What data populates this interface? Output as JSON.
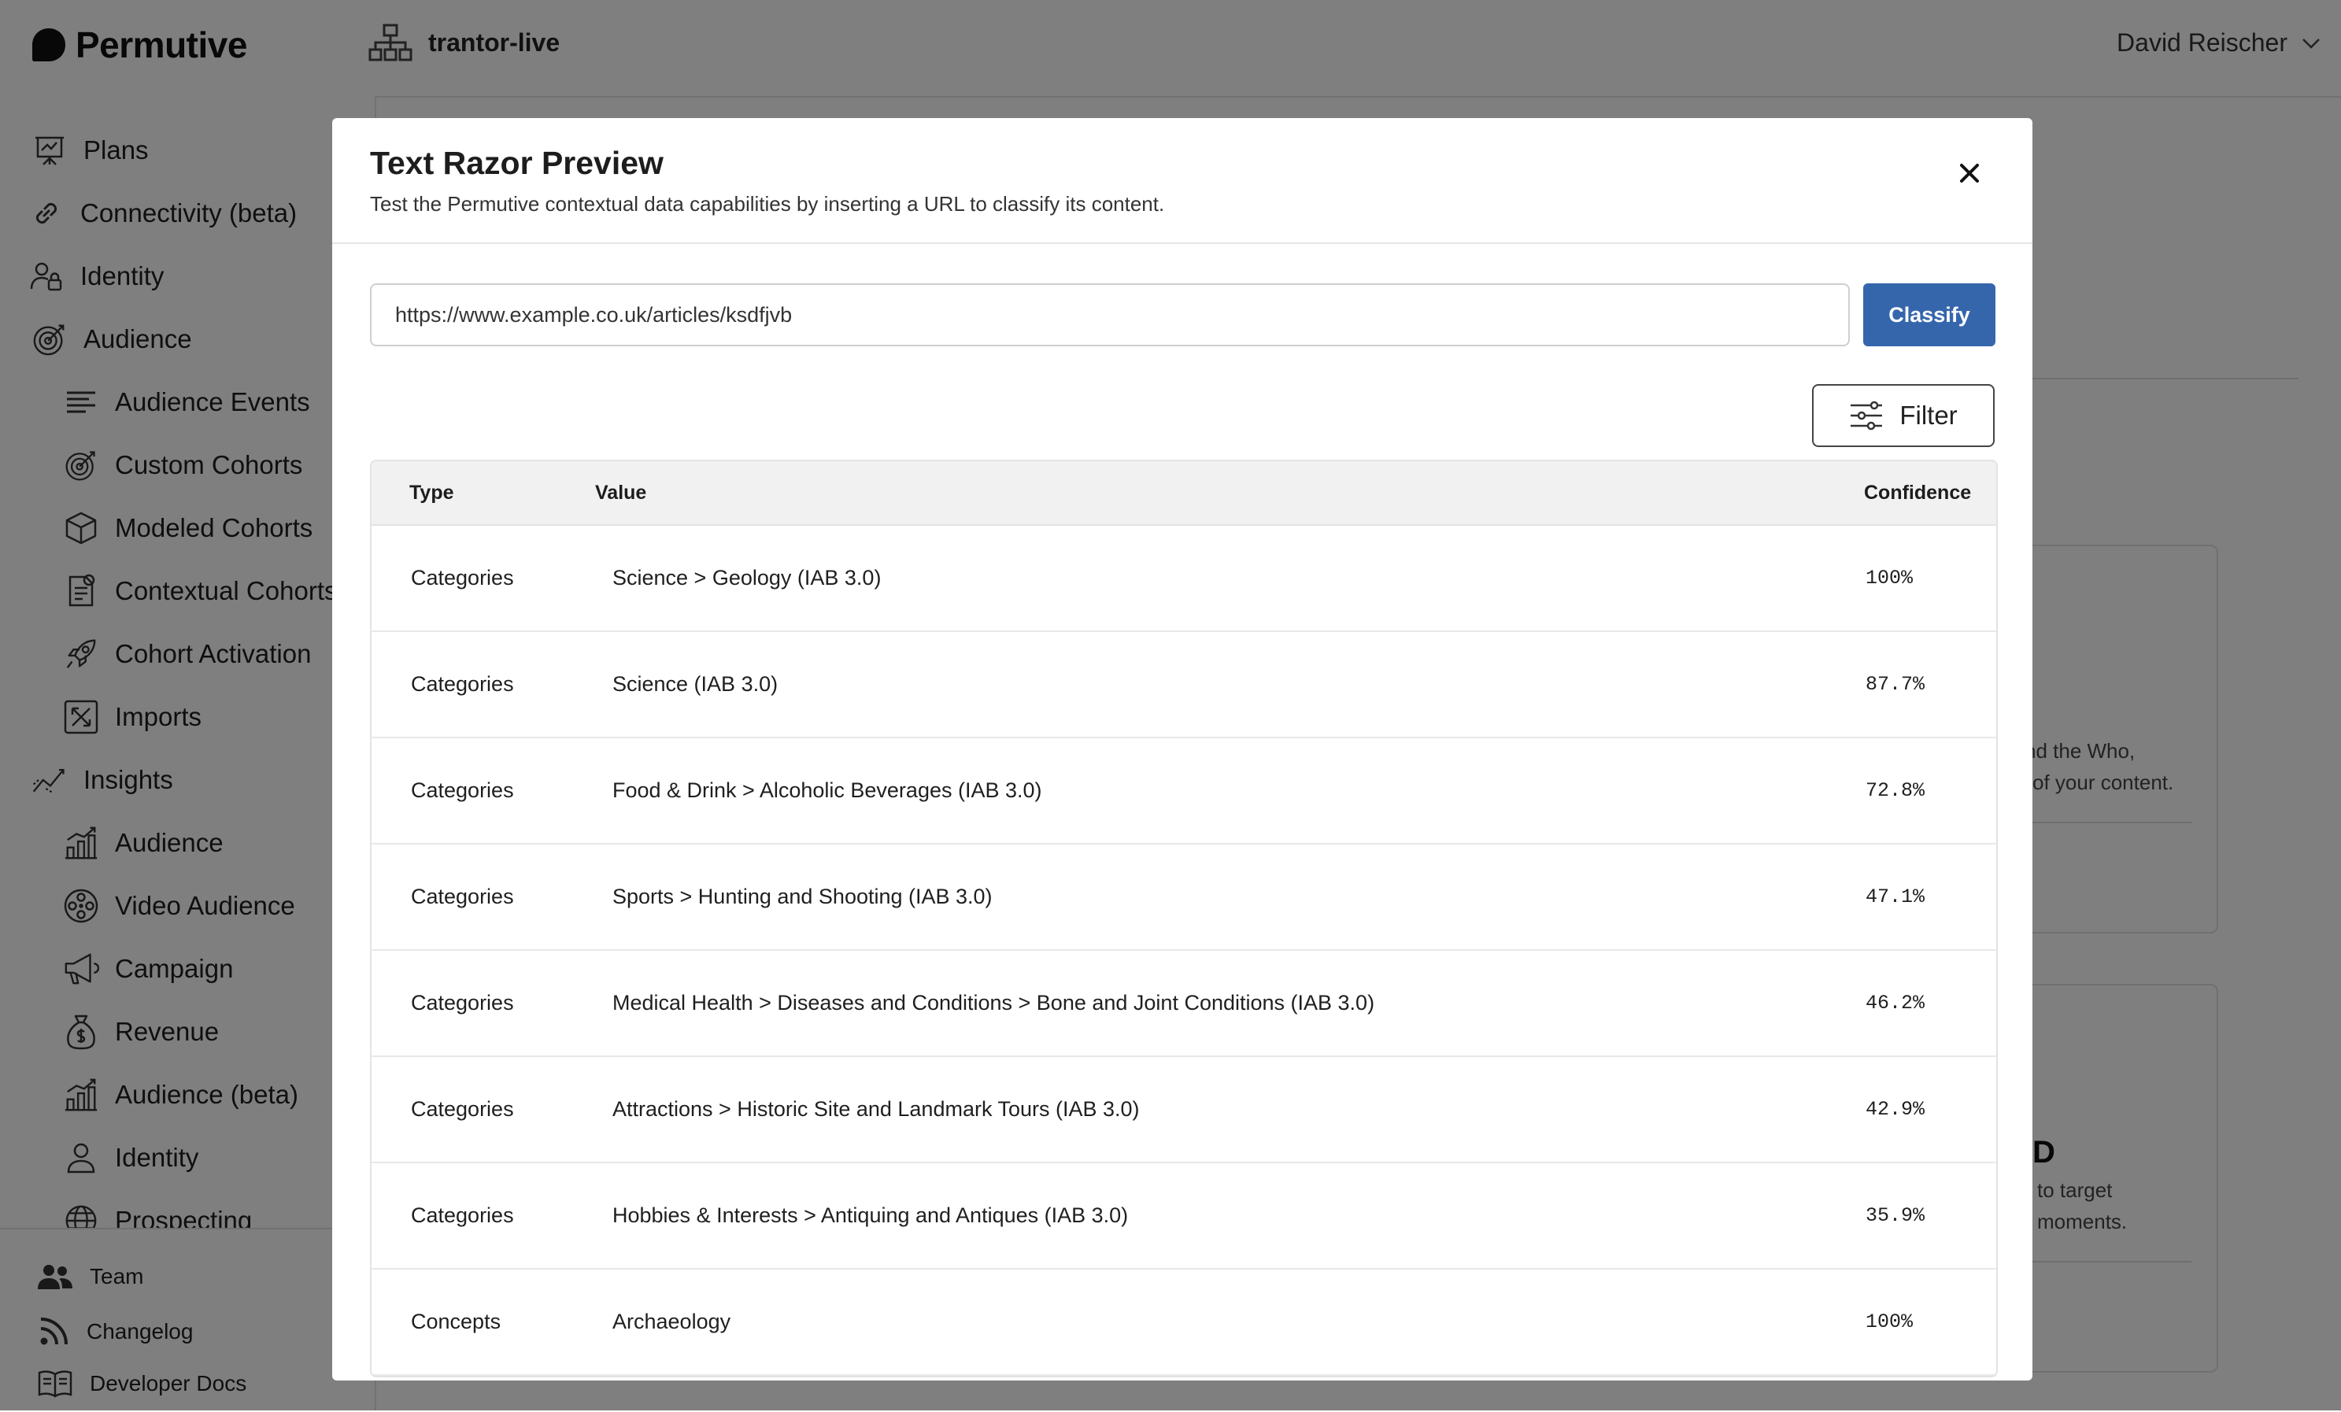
{
  "app": {
    "brand": "Permutive",
    "workspace": "trantor-live",
    "user": "David Reischer"
  },
  "sidebar": {
    "items": [
      {
        "label": "Plans",
        "icon": "presentation-board-icon"
      },
      {
        "label": "Connectivity (beta)",
        "icon": "link-icon"
      },
      {
        "label": "Identity",
        "icon": "user-lock-icon"
      },
      {
        "label": "Audience",
        "icon": "target-arrow-icon"
      },
      {
        "label": "Audience Events",
        "icon": "lines-icon"
      },
      {
        "label": "Custom Cohorts",
        "icon": "target-arrow-icon"
      },
      {
        "label": "Modeled Cohorts",
        "icon": "cube-icon"
      },
      {
        "label": "Contextual Cohorts",
        "icon": "document-icon"
      },
      {
        "label": "Cohort Activation",
        "icon": "rocket-icon"
      },
      {
        "label": "Imports",
        "icon": "import-box-icon"
      },
      {
        "label": "Insights",
        "icon": "trend-line-icon"
      },
      {
        "label": "Audience",
        "icon": "bar-chart-icon"
      },
      {
        "label": "Video Audience",
        "icon": "film-reel-icon"
      },
      {
        "label": "Campaign",
        "icon": "megaphone-icon"
      },
      {
        "label": "Revenue",
        "icon": "money-bag-icon"
      },
      {
        "label": "Audience (beta)",
        "icon": "bar-chart-icon"
      },
      {
        "label": "Identity",
        "icon": "person-icon"
      },
      {
        "label": "Prospecting",
        "icon": "globe-icon"
      }
    ],
    "bottom": [
      {
        "label": "Team",
        "icon": "team-icon"
      },
      {
        "label": "Changelog",
        "icon": "rss-icon"
      },
      {
        "label": "Developer Docs",
        "icon": "book-icon"
      }
    ]
  },
  "background": {
    "card1_text": [
      "nd the Who,",
      "of your content."
    ],
    "card2_heading": "D",
    "card2_text": [
      "to target",
      "moments."
    ]
  },
  "modal": {
    "title": "Text Razor Preview",
    "subtitle": "Test the Permutive contextual data capabilities by inserting a URL to classify its content.",
    "url_value": "https://www.example.co.uk/articles/ksdfjvb",
    "classify_label": "Classify",
    "filter_label": "Filter",
    "table": {
      "headers": {
        "type": "Type",
        "value": "Value",
        "confidence": "Confidence"
      },
      "rows": [
        {
          "type": "Categories",
          "value": "Science > Geology (IAB 3.0)",
          "confidence": "100%"
        },
        {
          "type": "Categories",
          "value": "Science (IAB 3.0)",
          "confidence": "87.7%"
        },
        {
          "type": "Categories",
          "value": "Food & Drink > Alcoholic Beverages (IAB 3.0)",
          "confidence": "72.8%"
        },
        {
          "type": "Categories",
          "value": "Sports > Hunting and Shooting (IAB 3.0)",
          "confidence": "47.1%"
        },
        {
          "type": "Categories",
          "value": "Medical Health > Diseases and Conditions > Bone and Joint Conditions (IAB 3.0)",
          "confidence": "46.2%"
        },
        {
          "type": "Categories",
          "value": "Attractions > Historic Site and Landmark Tours (IAB 3.0)",
          "confidence": "42.9%"
        },
        {
          "type": "Categories",
          "value": "Hobbies & Interests > Antiquing and Antiques (IAB 3.0)",
          "confidence": "35.9%"
        },
        {
          "type": "Concepts",
          "value": "Archaeology",
          "confidence": "100%"
        }
      ]
    }
  },
  "colors": {
    "primary": "#3566ac",
    "overlay": "rgba(0,0,0,0.5)"
  }
}
